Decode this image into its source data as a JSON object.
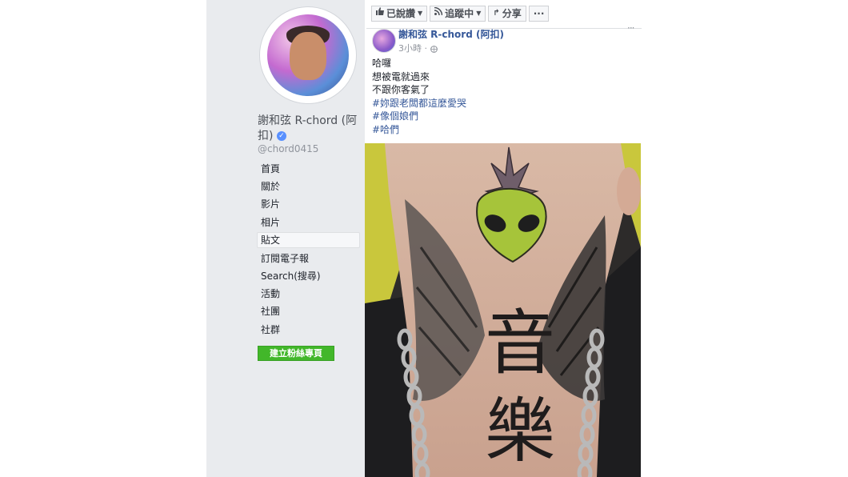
{
  "sidebar": {
    "page_name": "謝和弦 R-chord (阿扣)",
    "verified_icon": "verified-badge-icon",
    "handle": "@chord0415",
    "nav_items": [
      {
        "label": "首頁"
      },
      {
        "label": "關於"
      },
      {
        "label": "影片"
      },
      {
        "label": "相片"
      },
      {
        "label": "貼文"
      },
      {
        "label": "訂閱電子報"
      },
      {
        "label": "Search(搜尋)"
      },
      {
        "label": "活動"
      },
      {
        "label": "社團"
      },
      {
        "label": "社群"
      }
    ],
    "create_page_label": "建立粉絲專頁"
  },
  "toolbar": {
    "liked_label": "已說讚",
    "following_label": "追蹤中",
    "share_label": "分享",
    "more_label": "···"
  },
  "post": {
    "author": "謝和弦 R-chord (阿扣)",
    "time": "3小時 · ",
    "lines": [
      "哈囉",
      "想被電就過來",
      "不跟你客氣了"
    ],
    "hashtags": [
      "#妳跟老闆都這麼愛哭",
      "#像個娘們",
      "#哈們"
    ],
    "more_icon": "···"
  },
  "photo": {
    "tattoo_text": [
      "音",
      "樂"
    ]
  },
  "colors": {
    "sidebar_bg": "#e9ebee",
    "link": "#365899",
    "green_button": "#42b72a",
    "alien_green": "#a6c43a"
  }
}
